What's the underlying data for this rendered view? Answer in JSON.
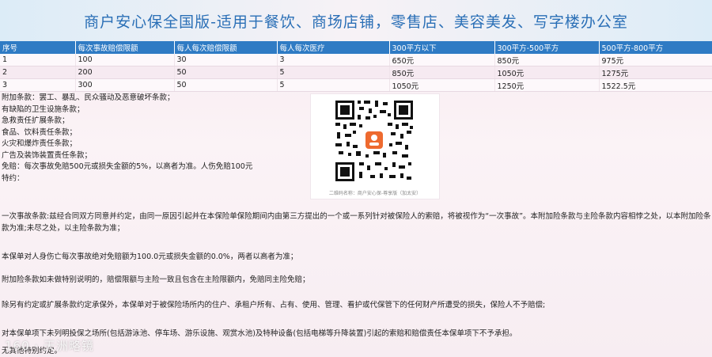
{
  "page_title": "商户安心保全国版-适用于餐饮、商场店铺，零售店、美容美发、写字楼办公室",
  "table": {
    "headers": [
      "序号",
      "每次事故赔偿限额",
      "每人每次赔偿限额",
      "每人每次医疗",
      "300平方以下",
      "300平方-500平方",
      "500平方-800平方"
    ],
    "rows": [
      [
        "1",
        "100",
        "30",
        "3",
        "650元",
        "850元",
        "975元"
      ],
      [
        "2",
        "200",
        "50",
        "5",
        "850元",
        "1050元",
        "1275元"
      ],
      [
        "3",
        "300",
        "50",
        "5",
        "1050元",
        "1250元",
        "1522.5元"
      ]
    ]
  },
  "clauses": [
    "附加条款：罢工、暴乱、民众骚动及恶意破坏条款；",
    "有缺陷的卫生设施条款；",
    "急救责任扩展条款；",
    "食品、饮料责任条款；",
    "火灾和爆炸责任条款；",
    "广告及装饰装置责任条款；",
    "免赔：每次事故免赔500元或损失金额的5%，以高者为准。人伤免赔100元",
    "特约："
  ],
  "qr": {
    "caption": "二维码名称：商户安心保-尊享版（加太安）"
  },
  "paragraphs": [
    "一次事故条款:兹经合同双方同意并约定，由同一原因引起并在本保险单保险期间内由第三方提出的一个或一系列针对被保险人的索赔，将被视作为“一次事故”。本附加险条款与主险条款内容相悖之处，以本附加险条款为准;未尽之处，以主险条款为准；",
    "本保单对人身伤亡每次事故绝对免赔额为100.0元或损失金额的0.0%，两者以高者为准；",
    "附加险条款如未做特别说明的，赔偿限额与主险一致且包含在主险限额内，免赔同主险免赔；",
    "除另有约定或扩展条款约定承保外，本保单对于被保险场所内的住户、承租户所有、占有、使用、管理、看护或代保管下的任何财产所遭受的损失，保险人不予赔偿;",
    "对本保单项下未列明投保之场所(包括游泳池、停车场、游乐设施、观赏水池)及特种设备(包括电梯等升降装置)引起的索赔和赔偿责任本保单项下不予承担。",
    "无其他特别约定。"
  ],
  "watermark": "160 · 天洲略镜"
}
